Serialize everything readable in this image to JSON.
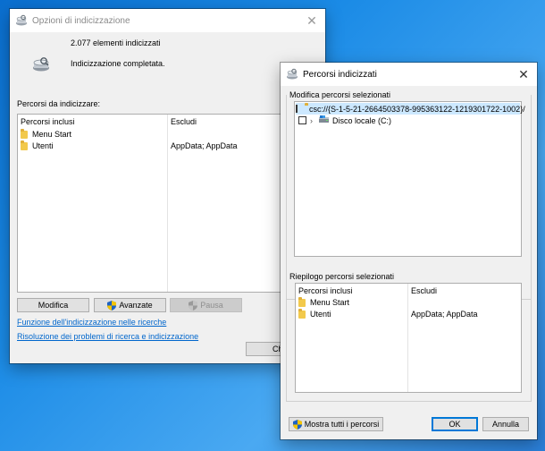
{
  "indexing_options": {
    "title": "Opzioni di indicizzazione",
    "items_indexed": "2.077 elementi indicizzati",
    "status": "Indicizzazione completata.",
    "locations_label": "Percorsi da indicizzare:",
    "columns": {
      "included": "Percorsi inclusi",
      "excluded": "Escludi"
    },
    "rows": [
      {
        "name": "Menu Start",
        "excluded": ""
      },
      {
        "name": "Utenti",
        "excluded": "AppData; AppData"
      }
    ],
    "buttons": {
      "modify": "Modifica",
      "advanced": "Avanzate",
      "pause": "Pausa",
      "close": "Ch"
    },
    "links": {
      "search_function": "Funzione dell'indicizzazione nelle ricerche",
      "troubleshoot": "Risoluzione dei problemi di ricerca e indicizzazione"
    }
  },
  "indexed_locations": {
    "title": "Percorsi indicizzati",
    "modify_label": "Modifica percorsi selezionati",
    "tree": [
      {
        "label": "csc://{S-1-5-21-2664503378-995363122-1219301722-1002}/",
        "checked": false,
        "expandable": false,
        "selected": true
      },
      {
        "label": "Disco locale (C:)",
        "checked": false,
        "expandable": true,
        "selected": false
      }
    ],
    "summary_label": "Riepilogo percorsi selezionati",
    "columns": {
      "included": "Percorsi inclusi",
      "excluded": "Escludi"
    },
    "rows": [
      {
        "name": "Menu Start",
        "excluded": ""
      },
      {
        "name": "Utenti",
        "excluded": "AppData; AppData"
      }
    ],
    "buttons": {
      "show_all": "Mostra tutti i percorsi",
      "ok": "OK",
      "cancel": "Annulla"
    }
  },
  "colors": {
    "desktop": "#1b8be6",
    "link": "#0066cc",
    "selection": "#cce8ff",
    "focus_border": "#0078d7"
  }
}
